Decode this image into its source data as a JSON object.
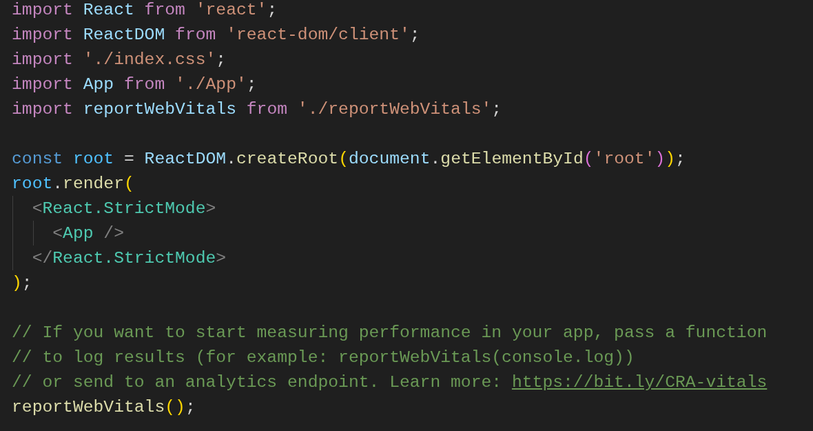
{
  "editor": {
    "blocks": [
      {
        "lines": [
          {
            "tokens": [
              {
                "kind": "keyword",
                "text": "import "
              },
              {
                "kind": "variable",
                "text": "React "
              },
              {
                "kind": "keyword",
                "text": "from "
              },
              {
                "kind": "string",
                "text": "'react'"
              },
              {
                "kind": "plain",
                "text": ";"
              }
            ]
          },
          {
            "tokens": [
              {
                "kind": "keyword",
                "text": "import "
              },
              {
                "kind": "variable",
                "text": "ReactDOM "
              },
              {
                "kind": "keyword",
                "text": "from "
              },
              {
                "kind": "string",
                "text": "'react-dom/client'"
              },
              {
                "kind": "plain",
                "text": ";"
              }
            ]
          },
          {
            "tokens": [
              {
                "kind": "keyword",
                "text": "import "
              },
              {
                "kind": "string",
                "text": "'./index.css'"
              },
              {
                "kind": "plain",
                "text": ";"
              }
            ]
          },
          {
            "tokens": [
              {
                "kind": "keyword",
                "text": "import "
              },
              {
                "kind": "variable",
                "text": "App "
              },
              {
                "kind": "keyword",
                "text": "from "
              },
              {
                "kind": "string",
                "text": "'./App'"
              },
              {
                "kind": "plain",
                "text": ";"
              }
            ]
          },
          {
            "tokens": [
              {
                "kind": "keyword",
                "text": "import "
              },
              {
                "kind": "variable",
                "text": "reportWebVitals "
              },
              {
                "kind": "keyword",
                "text": "from "
              },
              {
                "kind": "string",
                "text": "'./reportWebVitals'"
              },
              {
                "kind": "plain",
                "text": ";"
              }
            ]
          }
        ]
      },
      {
        "lines": [
          {
            "tokens": [
              {
                "kind": "storage",
                "text": "const "
              },
              {
                "kind": "constant",
                "text": "root "
              },
              {
                "kind": "plain",
                "text": "= "
              },
              {
                "kind": "variable",
                "text": "ReactDOM"
              },
              {
                "kind": "plain",
                "text": "."
              },
              {
                "kind": "function",
                "text": "createRoot"
              },
              {
                "kind": "bracket1",
                "text": "("
              },
              {
                "kind": "variable",
                "text": "document"
              },
              {
                "kind": "plain",
                "text": "."
              },
              {
                "kind": "function",
                "text": "getElementById"
              },
              {
                "kind": "bracket2",
                "text": "("
              },
              {
                "kind": "string",
                "text": "'root'"
              },
              {
                "kind": "bracket2",
                "text": ")"
              },
              {
                "kind": "bracket1",
                "text": ")"
              },
              {
                "kind": "plain",
                "text": ";"
              }
            ]
          },
          {
            "tokens": [
              {
                "kind": "constant",
                "text": "root"
              },
              {
                "kind": "plain",
                "text": "."
              },
              {
                "kind": "function",
                "text": "render"
              },
              {
                "kind": "bracket1",
                "text": "("
              }
            ]
          },
          {
            "tokens": [
              {
                "kind": "punct",
                "text": "  <"
              },
              {
                "kind": "tag",
                "text": "React.StrictMode"
              },
              {
                "kind": "punct",
                "text": ">"
              }
            ]
          },
          {
            "tokens": [
              {
                "kind": "punct",
                "text": "    <"
              },
              {
                "kind": "tag",
                "text": "App "
              },
              {
                "kind": "punct",
                "text": "/>"
              }
            ]
          },
          {
            "tokens": [
              {
                "kind": "punct",
                "text": "  </"
              },
              {
                "kind": "tag",
                "text": "React.StrictMode"
              },
              {
                "kind": "punct",
                "text": ">"
              }
            ]
          },
          {
            "tokens": [
              {
                "kind": "bracket1",
                "text": ")"
              },
              {
                "kind": "plain",
                "text": ";"
              }
            ]
          }
        ]
      },
      {
        "lines": [
          {
            "tokens": [
              {
                "kind": "comment",
                "text": "// If you want to start measuring performance in your app, pass a function"
              }
            ]
          },
          {
            "tokens": [
              {
                "kind": "comment",
                "text": "// to log results (for example: reportWebVitals(console.log))"
              }
            ]
          },
          {
            "tokens": [
              {
                "kind": "comment",
                "text": "// or send to an analytics endpoint. Learn more: "
              },
              {
                "kind": "link",
                "text": "https://bit.ly/CRA-vitals"
              }
            ]
          },
          {
            "tokens": [
              {
                "kind": "function",
                "text": "reportWebVitals"
              },
              {
                "kind": "bracket1",
                "text": "("
              },
              {
                "kind": "bracket1",
                "text": ")"
              },
              {
                "kind": "plain",
                "text": ";"
              }
            ]
          }
        ]
      }
    ]
  }
}
